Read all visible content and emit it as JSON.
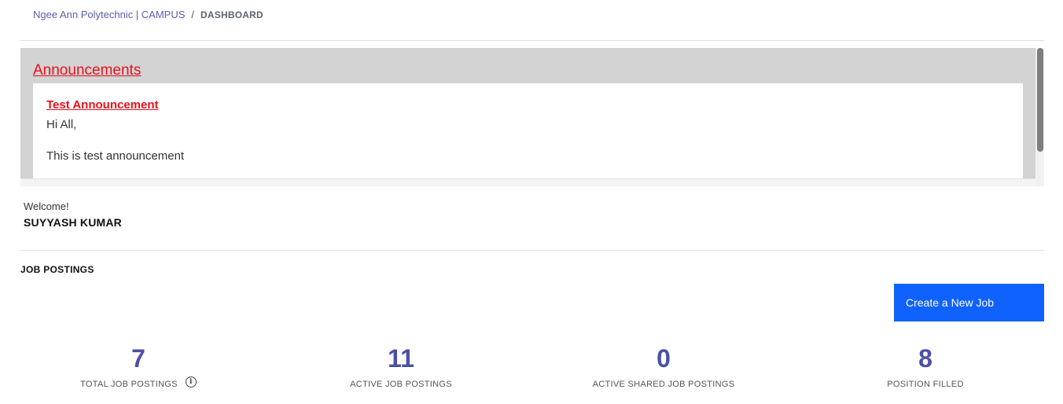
{
  "breadcrumb": {
    "org": "Ngee Ann Polytechnic | CAMPUS",
    "separator": "/",
    "current": "DASHBOARD"
  },
  "announcements": {
    "title": "Announcements",
    "items": [
      {
        "title": "Test Announcement",
        "greeting": "Hi All,",
        "body": "This is test announcement"
      }
    ]
  },
  "welcome": {
    "label": "Welcome!",
    "name": "SUYYASH KUMAR"
  },
  "job_postings": {
    "section_title": "JOB POSTINGS",
    "create_button_label": "Create a New Job",
    "stats": [
      {
        "value": "7",
        "label": "TOTAL JOB POSTINGS",
        "icon": "info-icon"
      },
      {
        "value": "11",
        "label": "ACTIVE JOB POSTINGS"
      },
      {
        "value": "0",
        "label": "ACTIVE SHARED JOB POSTINGS"
      },
      {
        "value": "8",
        "label": "POSITION FILLED"
      }
    ]
  },
  "colors": {
    "accent": "#0f62fe",
    "stat_value": "#4b50a6",
    "announcement_red": "#e8111b",
    "breadcrumb_link": "#5a5fad"
  }
}
